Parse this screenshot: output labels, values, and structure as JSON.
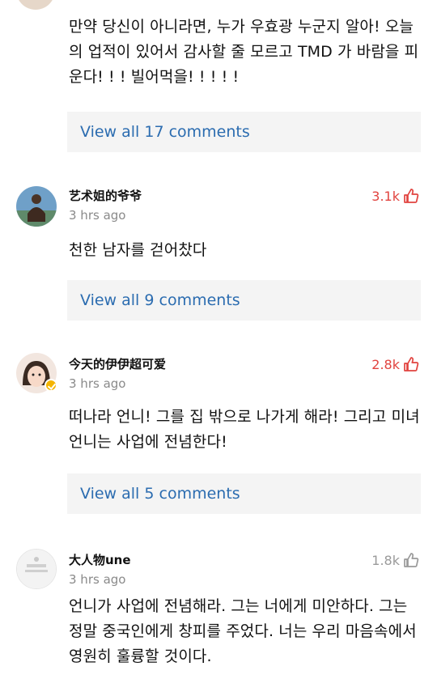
{
  "comments": [
    {
      "id": "c0",
      "text": "만약 당신이 아니라면, 누가 우효광 누군지 알아! 오늘의 업적이 있어서 감사할 줄 모르고 TMD 가 바람을 피운다! ! ! 빌어먹을! ! ! ! !",
      "view_all": "View all 17 comments"
    },
    {
      "id": "c1",
      "username": "艺术姐的爷爷",
      "time": "3 hrs ago",
      "likes": "3.1k",
      "text": "천한 남자를 걷어찼다",
      "view_all": "View all 9 comments"
    },
    {
      "id": "c2",
      "username": "今天的伊伊超可爱",
      "time": "3 hrs ago",
      "likes": "2.8k",
      "text": "떠나라 언니! 그를 집 밖으로 나가게 해라! 그리고 미녀 언니는 사업에 전념한다!",
      "view_all": "View all 5 comments"
    },
    {
      "id": "c3",
      "username": "大人物une",
      "time": "3 hrs ago",
      "likes": "1.8k",
      "text": "언니가 사업에 전념해라. 그는 너에게 미안하다. 그는 정말 중국인에게 창피를 주었다. 너는 우리 마음속에서 영원히 훌륭할 것이다."
    }
  ],
  "colors": {
    "liked": "#e1433f",
    "unliked": "#9a9a9a",
    "link": "#2b6cb0",
    "panel": "#f4f4f4"
  },
  "icons": {
    "like": "thumbs-up-icon",
    "verified": "verified-badge-icon"
  }
}
